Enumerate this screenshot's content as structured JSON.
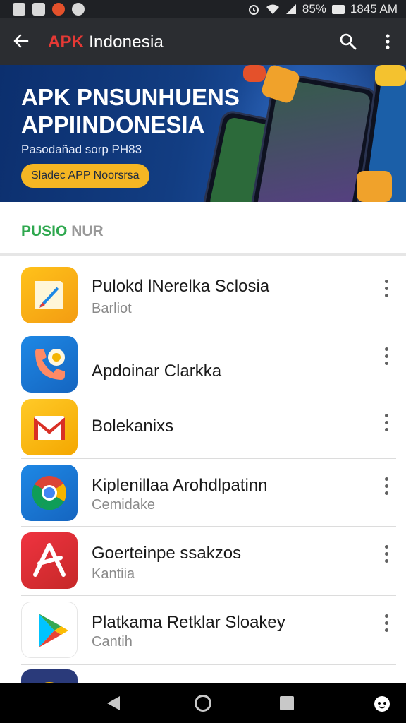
{
  "status_bar": {
    "battery": "85%",
    "time": "1845 AM",
    "icons": [
      "gallery-icon",
      "app-notification-icon",
      "red-notification-icon",
      "chat-icon",
      "alarm-icon",
      "wifi-icon",
      "signal-icon",
      "battery-icon"
    ]
  },
  "app_bar": {
    "title_accent": "APK",
    "title_rest": " Indonesia",
    "back_icon": "arrow-left-icon",
    "search_icon": "search-icon",
    "more_icon": "more-vert-icon",
    "color": "#2b2d31"
  },
  "banner": {
    "headline_line1": "APK PNSUNHUENS",
    "headline_line2": "APPIINDONESIA",
    "subtitle": "Pasodañad sorp PH83",
    "cta": "Sladec APP Noorsrsa",
    "cta_color": "#f5b623"
  },
  "section": {
    "title_green": "PUSIO",
    "title_gray": " NUR",
    "accent_color": "#2fa84f"
  },
  "apps": [
    {
      "name": "Pulokd lNerelka Sclosia",
      "subtitle": "Barliot",
      "icon": "pencil-app-icon"
    },
    {
      "name": "Apdoinar Clarkka",
      "subtitle": "",
      "icon": "phone-app-icon"
    },
    {
      "name": "Bolekanixs",
      "subtitle": "",
      "icon": "gmail-icon"
    },
    {
      "name": "Kiplenillaa Arohdlpatinn",
      "subtitle": "Cemidake",
      "icon": "chrome-icon"
    },
    {
      "name": "Goerteinpe ssakzos",
      "subtitle": "Kantiia",
      "icon": "red-app-icon"
    },
    {
      "name": "Platkama Retklar Sloakey",
      "subtitle": "Cantih",
      "icon": "play-store-icon"
    }
  ],
  "nav_bar": {
    "icons": [
      "nav-back-icon",
      "nav-home-icon",
      "nav-recents-icon",
      "assistant-icon"
    ]
  }
}
